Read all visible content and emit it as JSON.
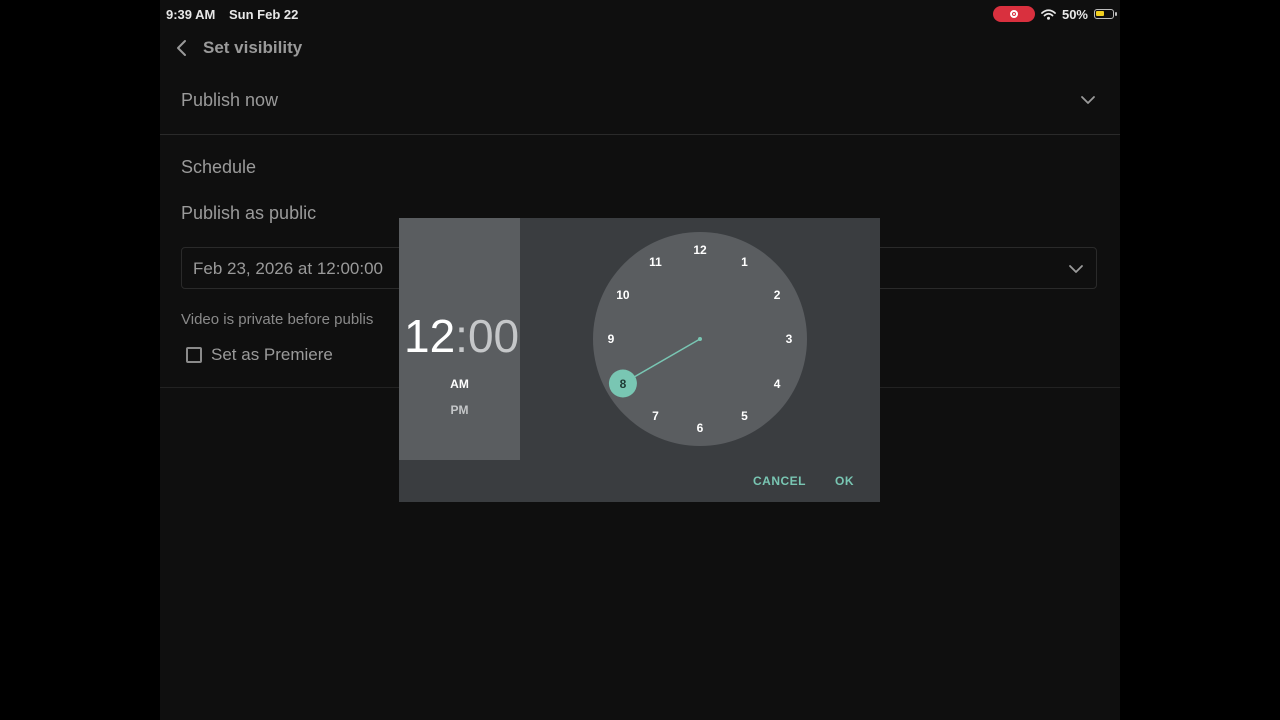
{
  "status_bar": {
    "time": "9:39 AM",
    "date": "Sun Feb 22",
    "battery": "50%",
    "recording_color": "#d9303e",
    "battery_fill_color": "#f2d020"
  },
  "header": {
    "title": "Set visibility",
    "back_icon": "chevron-left-icon"
  },
  "publish_now": {
    "label": "Publish now",
    "icon": "chevron-down-icon"
  },
  "schedule": {
    "section_label": "Schedule",
    "visibility_label": "Publish as public",
    "date_value": "Feb 23, 2026 at 12:00:00",
    "private_note": "Video is private before publis",
    "premiere_label": "Set as Premiere",
    "premiere_checked": false
  },
  "time_picker": {
    "hour": "12",
    "separator": ":",
    "minute": "00",
    "am_label": "AM",
    "pm_label": "PM",
    "selected_period": "AM",
    "dial_numbers": [
      "12",
      "1",
      "2",
      "3",
      "4",
      "5",
      "6",
      "7",
      "8",
      "9",
      "10",
      "11"
    ],
    "selected_dial_value": "8",
    "accent_color": "#79c6b3",
    "cancel_label": "CANCEL",
    "ok_label": "OK"
  }
}
